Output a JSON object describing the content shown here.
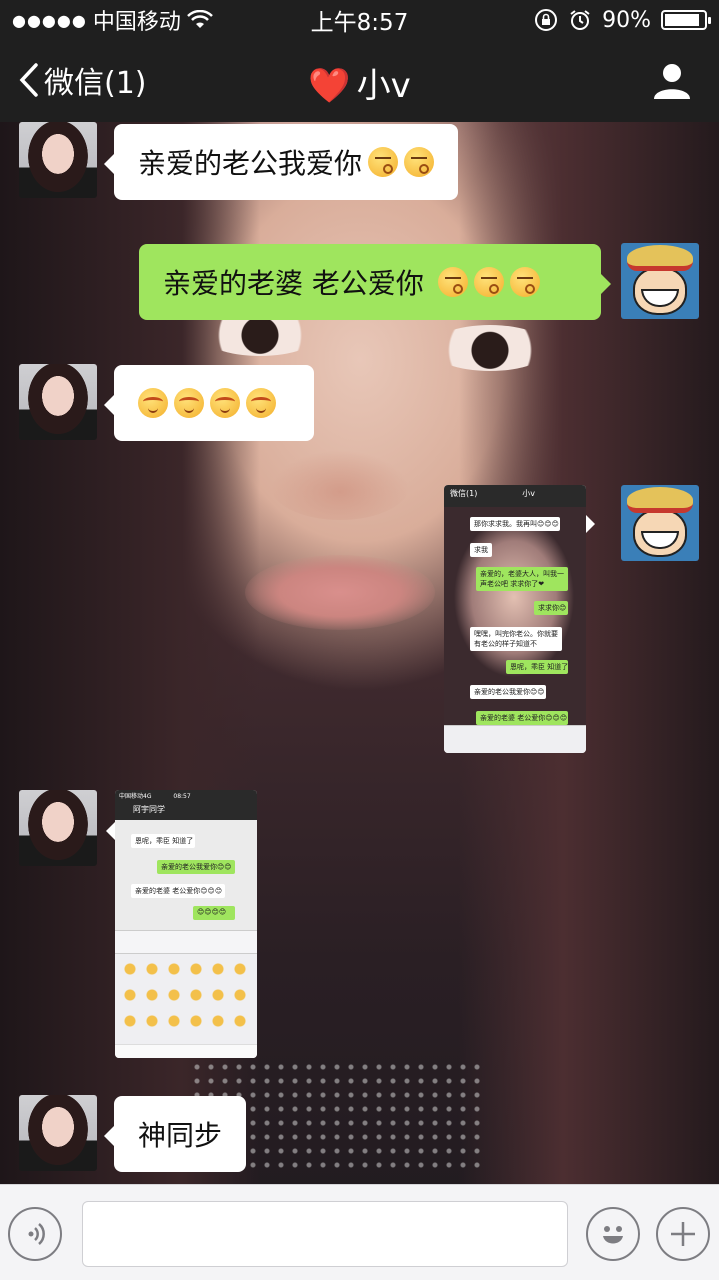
{
  "status_bar": {
    "signal_dots": "●●●●●",
    "carrier": "中国移动",
    "time": "上午8:57",
    "battery_percent": "90%",
    "battery_level": 0.9
  },
  "nav": {
    "back_label": "微信(1)",
    "title": "小v",
    "heart": "❤️"
  },
  "messages": [
    {
      "side": "left",
      "text": "亲爱的老公我爱你",
      "emojis": [
        "kiss",
        "kiss"
      ]
    },
    {
      "side": "right",
      "text": "亲爱的老婆 老公爱你",
      "emojis": [
        "kiss",
        "kiss",
        "kiss"
      ]
    },
    {
      "side": "left",
      "text": "",
      "emojis": [
        "blush",
        "blush",
        "blush",
        "blush"
      ]
    },
    {
      "side": "right",
      "type": "image",
      "description": "chat-screenshot"
    },
    {
      "side": "left",
      "type": "image",
      "description": "chat-screenshot"
    },
    {
      "side": "left",
      "text": "神同步",
      "emojis": []
    }
  ],
  "thumb1": {
    "back": "微信(1)",
    "title": "小v",
    "rows": [
      {
        "side": "w",
        "text": "那你求求我。我再叫😊😊😊"
      },
      {
        "side": "w",
        "text": "求我"
      },
      {
        "side": "g",
        "text": "亲爱的，老婆大人，叫我一声老公吧 求求你了❤"
      },
      {
        "side": "g",
        "text": "求求你😊"
      },
      {
        "side": "w",
        "text": "嘿嘿，叫完你老公。你就要有老公的样子知道不"
      },
      {
        "side": "g",
        "text": "恩呢，乖臣 知道了"
      },
      {
        "side": "w",
        "text": "亲爱的老公我爱你😊😊"
      },
      {
        "side": "g",
        "text": "亲爱的老婆 老公爱你😊😊😊"
      }
    ]
  },
  "thumb2": {
    "carrier": "中国移动4G",
    "time": "08:57",
    "title": "阿宇同学",
    "rows": [
      {
        "side": "w",
        "text": "恩呢，乖臣 知道了"
      },
      {
        "side": "g",
        "text": "亲爱的老公我爱你😊😊"
      },
      {
        "side": "w",
        "text": "亲爱的老婆 老公爱你😊😊😊"
      },
      {
        "side": "g",
        "text": "😊😊😊😊"
      }
    ]
  },
  "input_bar": {
    "voice_icon": "voice-icon",
    "emoji_icon": "emoji-icon",
    "plus_label": "+"
  }
}
